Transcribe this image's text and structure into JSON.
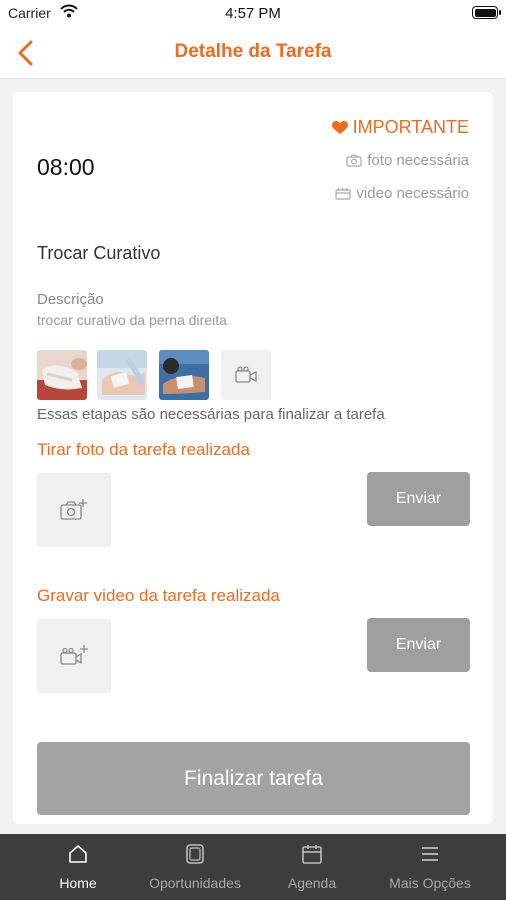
{
  "status_bar": {
    "carrier": "Carrier",
    "time": "4:57 PM"
  },
  "header": {
    "title": "Detalhe da Tarefa",
    "back_icon": "chevron-left-icon"
  },
  "task": {
    "time": "08:00",
    "importance": "IMPORTANTE",
    "photo_required": "foto necessária",
    "video_required": "video necessário",
    "title": "Trocar Curativo",
    "description_label": "Descrição",
    "description": "trocar curativo da perna direita",
    "steps_note": "Essas etapas são necessárias para finalizar a tarefa"
  },
  "photo_section": {
    "title": "Tirar foto da tarefa realizada",
    "send_label": "Enviar"
  },
  "video_section": {
    "title": "Gravar video da tarefa realizada",
    "send_label": "Enviar"
  },
  "finish_label": "Finalizar tarefa",
  "tabs": [
    {
      "label": "Home",
      "icon": "home-icon",
      "active": true
    },
    {
      "label": "Oportunidades",
      "icon": "square-icon",
      "active": false
    },
    {
      "label": "Agenda",
      "icon": "calendar-icon",
      "active": false
    },
    {
      "label": "Mais Opções",
      "icon": "menu-icon",
      "active": false
    }
  ],
  "colors": {
    "accent": "#ee6a1f",
    "tabbar": "#3d3d3d",
    "button_disabled": "#9f9f9f"
  }
}
